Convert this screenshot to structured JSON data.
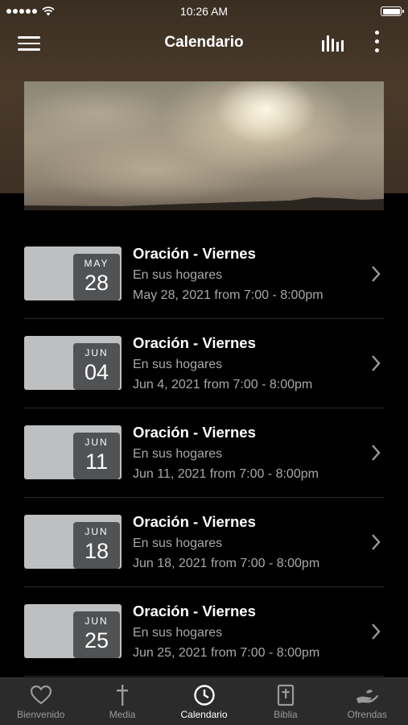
{
  "status_bar": {
    "time": "10:26 AM"
  },
  "header": {
    "title": "Calendario"
  },
  "events": [
    {
      "month": "MAY",
      "day": "28",
      "title": "Oración - Viernes",
      "location": "En sus hogares",
      "when": "May 28, 2021 from 7:00 - 8:00pm"
    },
    {
      "month": "JUN",
      "day": "04",
      "title": "Oración - Viernes",
      "location": "En sus hogares",
      "when": "Jun 4, 2021 from 7:00 - 8:00pm"
    },
    {
      "month": "JUN",
      "day": "11",
      "title": "Oración - Viernes",
      "location": "En sus hogares",
      "when": "Jun 11, 2021 from 7:00 - 8:00pm"
    },
    {
      "month": "JUN",
      "day": "18",
      "title": "Oración - Viernes",
      "location": "En sus hogares",
      "when": "Jun 18, 2021 from 7:00 - 8:00pm"
    },
    {
      "month": "JUN",
      "day": "25",
      "title": "Oración - Viernes",
      "location": "En sus hogares",
      "when": "Jun 25, 2021 from 7:00 - 8:00pm"
    }
  ],
  "tabs": [
    {
      "label": "Bienvenido",
      "icon": "heart-icon",
      "active": false
    },
    {
      "label": "Media",
      "icon": "cross-icon",
      "active": false
    },
    {
      "label": "Calendario",
      "icon": "clock-icon",
      "active": true
    },
    {
      "label": "Biblia",
      "icon": "bible-icon",
      "active": false
    },
    {
      "label": "Ofrendas",
      "icon": "hand-icon",
      "active": false
    }
  ],
  "colors": {
    "header_brown": "#4a3a2a",
    "tab_bar": "#2b2b2c",
    "badge": "#505254",
    "thumb": "#bdbfc1"
  }
}
